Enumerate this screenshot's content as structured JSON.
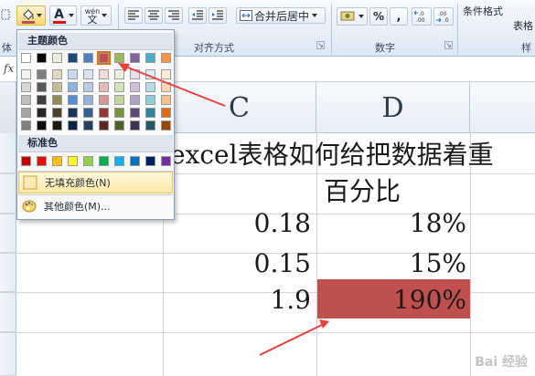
{
  "ribbon": {
    "font_group_partial": "体",
    "font_group_label_partial": "体",
    "align_group_label": "对齐方式",
    "merge_label": "合并后居中",
    "number_group_label": "数字",
    "percent_symbol": "%",
    "comma_symbol": ",",
    "inc_decimal": "←.0\n.00",
    "dec_decimal": ".00\n→.0",
    "cond_format_label": "条件格式",
    "table_label_partial": "表格",
    "style_group_label_partial": "样"
  },
  "formula_bar": {
    "fx": "fx"
  },
  "sheet": {
    "columns": [
      "C",
      "D"
    ],
    "title_text": "excel表格如何给把数据着重",
    "subtitle_text": "百分比",
    "rows": [
      {
        "c": "0.18",
        "d": "18%"
      },
      {
        "c": "0.15",
        "d": "15%"
      },
      {
        "c": "1.9",
        "d": "190%"
      }
    ],
    "highlight_fill": "#c0504d"
  },
  "color_menu": {
    "theme_header": "主题颜色",
    "standard_header": "标准色",
    "no_fill_label": "无填充颜色(N)",
    "more_colors_label": "其他颜色(M)...",
    "theme_colors": [
      "#ffffff",
      "#000000",
      "#eeece1",
      "#1f497d",
      "#4f81bd",
      "#c0504d",
      "#9bbb59",
      "#8064a2",
      "#4bacc6",
      "#f79646"
    ],
    "theme_shades": [
      [
        "#f2f2f2",
        "#d8d8d8",
        "#bfbfbf",
        "#a5a5a5",
        "#7f7f7f"
      ],
      [
        "#7f7f7f",
        "#595959",
        "#3f3f3f",
        "#262626",
        "#0c0c0c"
      ],
      [
        "#ddd9c3",
        "#c4bd97",
        "#938953",
        "#494429",
        "#1d1b10"
      ],
      [
        "#c6d9f0",
        "#8db3e2",
        "#548dd4",
        "#17365d",
        "#0f243e"
      ],
      [
        "#dbe5f1",
        "#b8cce4",
        "#95b3d7",
        "#366092",
        "#244061"
      ],
      [
        "#f2dcdb",
        "#e5b9b7",
        "#d99694",
        "#953734",
        "#632423"
      ],
      [
        "#ebf1dd",
        "#d7e3bc",
        "#c3d69b",
        "#76923c",
        "#4f6128"
      ],
      [
        "#e5e0ec",
        "#ccc1d9",
        "#b2a2c7",
        "#5f497a",
        "#3f3151"
      ],
      [
        "#dbeef3",
        "#b7dde8",
        "#92cddc",
        "#31859b",
        "#205867"
      ],
      [
        "#fdeada",
        "#fbd5b5",
        "#fac08f",
        "#e36c09",
        "#974806"
      ]
    ],
    "standard_colors": [
      "#c00000",
      "#ff0000",
      "#ffc000",
      "#ffff00",
      "#92d050",
      "#00b050",
      "#00b0f0",
      "#0070c0",
      "#002060",
      "#7030a0"
    ],
    "selected_index": 5
  },
  "icons": {
    "fill": "paint-bucket-icon",
    "font_color": "font-color-icon",
    "phonetic": "phonetic-guide-icon",
    "palette": "palette-icon"
  },
  "font_color_letter": "A",
  "phonetic_label": "wén",
  "watermark": "Bai 经验"
}
